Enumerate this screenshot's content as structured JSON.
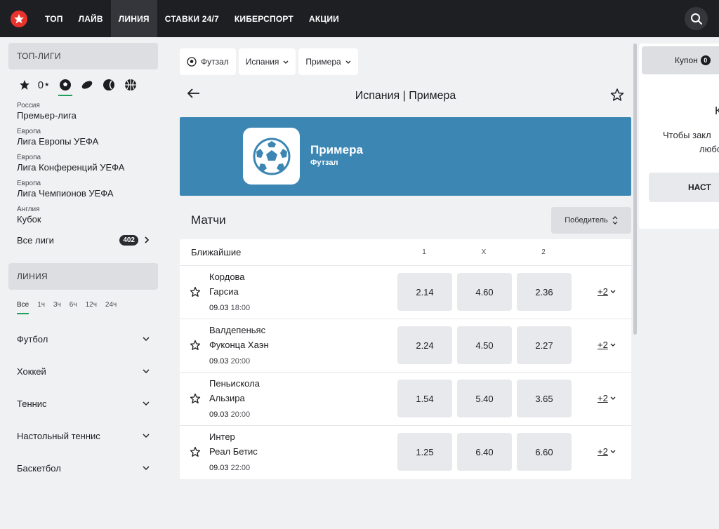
{
  "nav": {
    "items": [
      "ТОП",
      "ЛАЙВ",
      "ЛИНИЯ",
      "СТАВКИ 24/7",
      "КИБЕРСПОРТ",
      "АКЦИИ"
    ],
    "active_index": 2
  },
  "sidebar": {
    "top_leagues_header": "ТОП-ЛИГИ",
    "favorites_count": "0",
    "sport_icons": [
      "star-icon",
      "soccer-ball-icon",
      "hockey-puck-icon",
      "tennis-ball-icon",
      "basketball-icon"
    ],
    "leagues": [
      {
        "country": "Россия",
        "name": "Премьер-лига"
      },
      {
        "country": "Европа",
        "name": "Лига Европы УЕФА"
      },
      {
        "country": "Европа",
        "name": "Лига Конференций УЕФА"
      },
      {
        "country": "Европа",
        "name": "Лига Чемпионов УЕФА"
      },
      {
        "country": "Англия",
        "name": "Кубок"
      }
    ],
    "all_leagues_label": "Все лиги",
    "all_leagues_count": "402",
    "line_header": "ЛИНИЯ",
    "time_filters": [
      "Все",
      "1ч",
      "3ч",
      "6ч",
      "12ч",
      "24ч"
    ],
    "sports": [
      "Футбол",
      "Хоккей",
      "Теннис",
      "Настольный теннис",
      "Баскетбол"
    ]
  },
  "filters": {
    "sport": "Футзал",
    "country": "Испания",
    "league": "Примера"
  },
  "page_title": "Испания | Примера",
  "banner": {
    "title": "Примера",
    "subtitle": "Футзал",
    "color": "#3b86b3"
  },
  "matches": {
    "header": "Матчи",
    "sort_label": "Победитель",
    "group_label": "Ближайшие",
    "columns": [
      "1",
      "X",
      "2"
    ],
    "rows": [
      {
        "team1": "Кордова",
        "team2": "Гарсиа",
        "date": "09.03",
        "time": "18:00",
        "odds": [
          "2.14",
          "4.60",
          "2.36"
        ],
        "more": "+2"
      },
      {
        "team1": "Валдепеньяс",
        "team2": "Фуконца Хаэн",
        "date": "09.03",
        "time": "20:00",
        "odds": [
          "2.24",
          "4.50",
          "2.27"
        ],
        "more": "+2"
      },
      {
        "team1": "Пеньискола",
        "team2": "Альзира",
        "date": "09.03",
        "time": "20:00",
        "odds": [
          "1.54",
          "5.40",
          "3.65"
        ],
        "more": "+2"
      },
      {
        "team1": "Интер",
        "team2": "Реал Бетис",
        "date": "09.03",
        "time": "22:00",
        "odds": [
          "1.25",
          "6.40",
          "6.60"
        ],
        "more": "+2"
      }
    ]
  },
  "coupon": {
    "tab_label": "Купон",
    "count": "0",
    "heading": "К",
    "text_line1": "Чтобы закл",
    "text_line2": "любо",
    "button": "НАСТ"
  },
  "colors": {
    "accent_green": "#1fa05a",
    "topbar": "#1e1f23",
    "brand_red": "#e8322c"
  }
}
